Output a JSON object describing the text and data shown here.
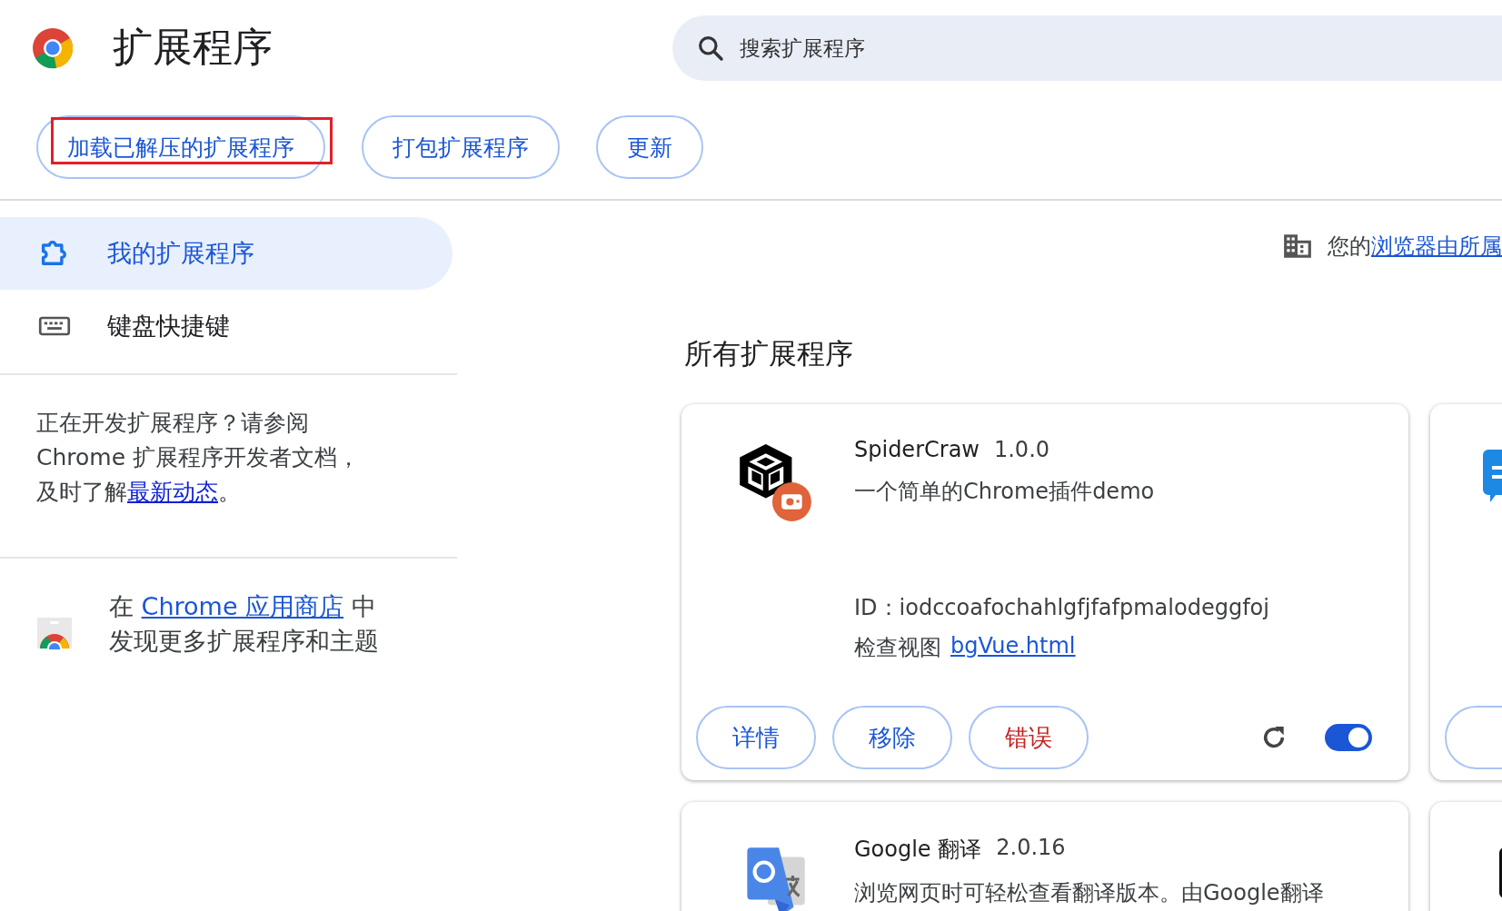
{
  "header": {
    "title": "扩展程序",
    "search": {
      "placeholder": "搜索扩展程序"
    }
  },
  "toolbar": {
    "buttons": [
      {
        "label": "加载已解压的扩展程序",
        "highlighted": true
      },
      {
        "label": "打包扩展程序",
        "highlighted": false
      },
      {
        "label": "更新",
        "highlighted": false
      }
    ]
  },
  "sidebar": {
    "items": [
      {
        "label": "我的扩展程序",
        "selected": true,
        "kind": "extensions"
      },
      {
        "label": "键盘快捷键",
        "selected": false,
        "kind": "keyboard"
      }
    ],
    "dev_note": {
      "text": "正在开发扩展程序？请参阅 Chrome 扩展程序开发者文档，及时了解",
      "link": "最新动态",
      "end": "。"
    },
    "store_note": {
      "before": "在 ",
      "link": "Chrome 应用商店",
      "after": " 中发现更多扩展程序和主题"
    }
  },
  "managed_notice": {
    "text": "您的",
    "link": "浏览器由所属"
  },
  "section_title": "所有扩展程序",
  "extensions": [
    {
      "kind": "full",
      "name": "SpiderCraw",
      "version": "1.0.0",
      "description": "一个简单的Chrome插件demo",
      "id_label": "ID：",
      "id": "iodccoafochahlgfjfafpmalodeggfoj",
      "inspect_label": "检查视图",
      "inspect_link": "bgVue.html",
      "buttons": [
        {
          "label": "详情",
          "kind": "normal"
        },
        {
          "label": "移除",
          "kind": "normal"
        },
        {
          "label": "错误",
          "kind": "error"
        }
      ],
      "enabled": true
    },
    {
      "kind": "cut"
    },
    {
      "kind": "full",
      "name": "Google 翻译",
      "version": "2.0.16",
      "description": "浏览网页时可轻松查看翻译版本。由Google翻译"
    },
    {
      "kind": "cut"
    }
  ]
}
